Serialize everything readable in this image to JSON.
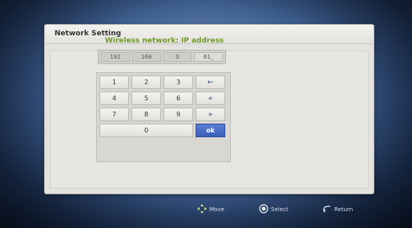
{
  "dialog": {
    "title": "Network Setting",
    "panel_title": "Wireless network: IP address"
  },
  "ip_address": {
    "octets": [
      "192",
      "168",
      "0",
      "61_"
    ],
    "active_index": 3
  },
  "keypad": {
    "keys": [
      "1",
      "2",
      "3",
      "←",
      "4",
      "5",
      "6",
      "«",
      "7",
      "8",
      "9",
      "»",
      "0",
      "ok"
    ]
  },
  "footer": {
    "move_label": "Move",
    "select_label": "Select",
    "return_label": "Return",
    "move_icon": "move-arrows-icon",
    "select_icon": "select-circle-icon",
    "return_icon": "return-arrow-icon"
  },
  "colors": {
    "accent_green": "#6f9a2a",
    "ok_blue": "#3a5fb8"
  }
}
